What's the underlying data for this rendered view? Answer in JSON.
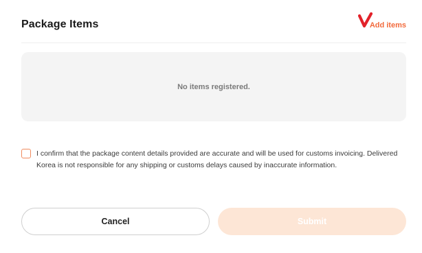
{
  "header": {
    "title": "Package Items",
    "add_items_label": "Add items"
  },
  "items": {
    "empty_message": "No items registered."
  },
  "confirmation": {
    "checked": false,
    "text": "I confirm that the package content details provided are accurate and will be used for customs invoicing. Delivered Korea is not responsible for any shipping or customs delays caused by inaccurate information."
  },
  "actions": {
    "cancel_label": "Cancel",
    "submit_label": "Submit",
    "submit_disabled": true
  },
  "colors": {
    "accent": "#f26a3c",
    "check_mark": "#e2222a",
    "submit_disabled_bg": "#fde6d6",
    "empty_box_bg": "#f4f4f4"
  },
  "icons": {
    "add_items": "check-mark-icon"
  }
}
